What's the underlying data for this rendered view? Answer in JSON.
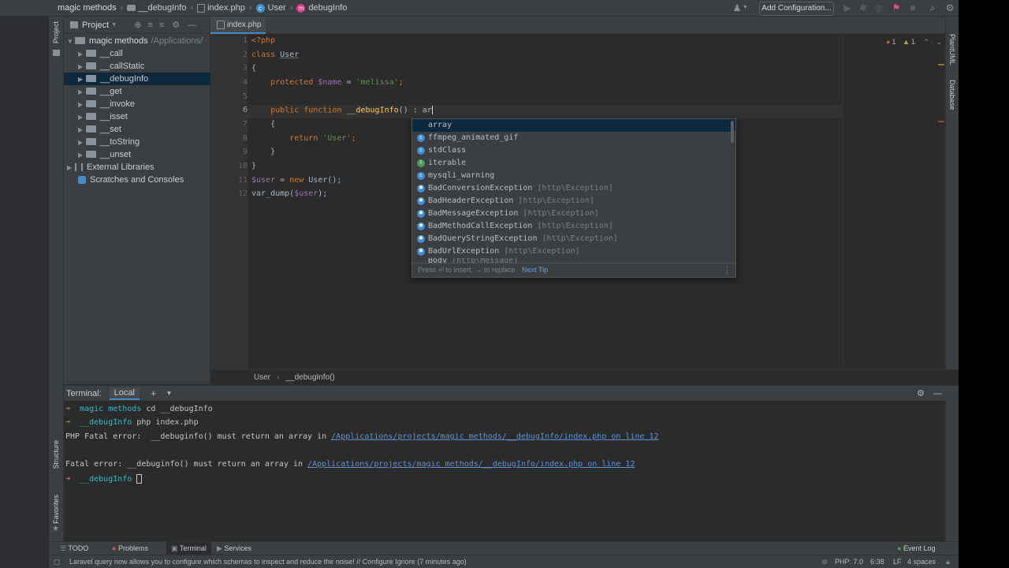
{
  "breadcrumbs": [
    "magic methods",
    "__debugInfo",
    "index.php",
    "User",
    "debugInfo"
  ],
  "toolbar": {
    "add_config": "Add Configuration..."
  },
  "left_stripe": {
    "project": "Project",
    "structure": "Structure",
    "favorites": "Favorites"
  },
  "right_stripe": {
    "plantuml": "PlantUML",
    "database": "Database"
  },
  "project_panel": {
    "title": "Project",
    "root": {
      "name": "magic methods",
      "path": "/Applications/"
    },
    "items": [
      "__call",
      "__callStatic",
      "__debugInfo",
      "__get",
      "__invoke",
      "__isset",
      "__set",
      "__toString",
      "__unset"
    ],
    "external": "External Libraries",
    "scratches": "Scratches and Consoles"
  },
  "editor": {
    "tab": "index.php",
    "line_numbers": [
      "1",
      "2",
      "3",
      "4",
      "5",
      "6",
      "7",
      "8",
      "9",
      "10",
      "11",
      "12"
    ],
    "inspections": {
      "errors": "1",
      "warnings": "1"
    },
    "breadcrumb_class": "User",
    "breadcrumb_method": "__debugInfo()"
  },
  "code": {
    "l1": "<?php",
    "l2_kw": "class",
    "l2_name": "User",
    "l3": "{",
    "l4_kw": "protected",
    "l4_var": "$name",
    "l4_eq": " = ",
    "l4_str": "'melissa'",
    "l4_end": ";",
    "l6_kw": "public function",
    "l6_fn": "__debugInfo",
    "l6_rest": "() : ar",
    "l7": "{",
    "l8_kw": "return",
    "l8_str": "'User'",
    "l8_end": ";",
    "l9": "}",
    "l10": "}",
    "l11_var": "$user",
    "l11_eq": " = ",
    "l11_kw": "new",
    "l11_rest": " User();",
    "l12_fn": "var_dump(",
    "l12_var": "$user",
    "l12_end": ");"
  },
  "completion": {
    "items": [
      {
        "label": "array",
        "ns": "",
        "icon": ""
      },
      {
        "label": "ffmpeg_animated_gif",
        "ns": "",
        "icon": "c"
      },
      {
        "label": "stdClass",
        "ns": "",
        "icon": "c"
      },
      {
        "label": "iterable",
        "ns": "",
        "icon": "i"
      },
      {
        "label": "mysqli_warning",
        "ns": "",
        "icon": "c"
      },
      {
        "label": "BadConversionException",
        "ns": "[http\\Exception]",
        "icon": "x"
      },
      {
        "label": "BadHeaderException",
        "ns": "[http\\Exception]",
        "icon": "x"
      },
      {
        "label": "BadMessageException",
        "ns": "[http\\Exception]",
        "icon": "x"
      },
      {
        "label": "BadMethodCallException",
        "ns": "[http\\Exception]",
        "icon": "x"
      },
      {
        "label": "BadQueryStringException",
        "ns": "[http\\Exception]",
        "icon": "x"
      },
      {
        "label": "BadUrlException",
        "ns": "[http\\Exception]",
        "icon": "x"
      },
      {
        "label": "Body",
        "ns": "[http\\Message]",
        "icon": "c"
      }
    ],
    "footer": "Press ⏎ to insert, → to replace",
    "next_tip": "Next Tip"
  },
  "terminal": {
    "label": "Terminal:",
    "tab": "Local",
    "lines": {
      "l1_dir": "magic methods",
      "l1_cmd": " cd __debugInfo",
      "l2_dir": "__debugInfo",
      "l2_cmd": " php index.php",
      "l3_text": "PHP Fatal error:  __debuginfo() must return an array in ",
      "l3_link": "/Applications/projects/magic methods/__debugInfo/index.php on line 12",
      "l5_text": "Fatal error: __debuginfo() must return an array in ",
      "l5_link": "/Applications/projects/magic methods/__debugInfo/index.php on line 12",
      "l6_dir": "__debugInfo"
    }
  },
  "tool_windows": {
    "todo": "TODO",
    "problems": "Problems",
    "terminal": "Terminal",
    "services": "Services",
    "event_log": "Event Log"
  },
  "status": {
    "message": "Laravel query now allows you to configure which schemas to inspect and reduce the noise! // Configure   Ignore (7 minutes ago)",
    "php": "PHP: 7.0",
    "position": "6:38",
    "line_sep": "LF",
    "indent": "4 spaces"
  }
}
